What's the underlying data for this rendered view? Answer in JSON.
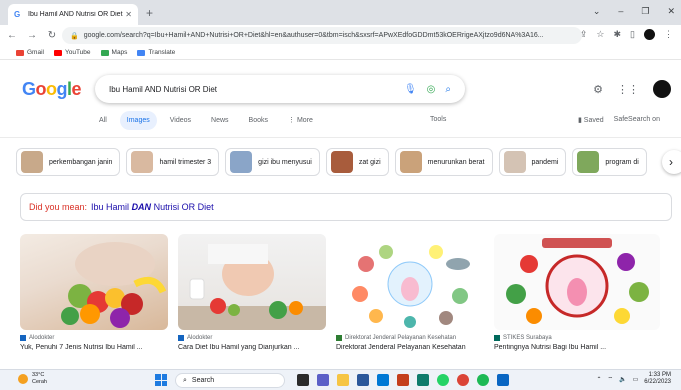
{
  "browser": {
    "tab_title": "Ibu Hamil AND Nutrisi OR Diet",
    "url": "google.com/search?q=Ibu+Hamil+AND+Nutrisi+OR+Diet&hl=en&authuser=0&tbm=isch&sxsrf=APwXEdfoGDDmt53kOERrigeAXjtzo9d6NA%3A16...",
    "bookmarks": [
      "Gmail",
      "YouTube",
      "Maps",
      "Translate"
    ]
  },
  "search": {
    "query": "Ibu Hamil AND Nutrisi OR Diet",
    "tabs": [
      "All",
      "Images",
      "Videos",
      "News",
      "Books",
      "More"
    ],
    "active_tab": "Images",
    "tools_label": "Tools",
    "saved_label": "Saved",
    "safesearch_label": "SafeSearch on"
  },
  "chips": [
    {
      "label": "perkembangan janin",
      "color": "#c8a98a"
    },
    {
      "label": "hamil trimester 3",
      "color": "#d9b9a0"
    },
    {
      "label": "gizi ibu menyusui",
      "color": "#8aa5c8"
    },
    {
      "label": "zat gizi",
      "color": "#a85c3c"
    },
    {
      "label": "menurunkan berat",
      "color": "#caa27a"
    },
    {
      "label": "pandemi",
      "color": "#d4c3b4"
    },
    {
      "label": "program di",
      "color": "#7fa85c"
    }
  ],
  "did_you_mean": {
    "lead": "Did you mean:",
    "pre": "Ibu Hamil",
    "bold": "DAN",
    "post": "Nutrisi OR Diet"
  },
  "results": [
    {
      "source": "Alodokter",
      "caption": "Yuk, Penuhi 7 Jenis Nutrisi Ibu Hamil ..."
    },
    {
      "source": "Alodokter",
      "caption": "Cara Diet Ibu Hamil yang Dianjurkan ..."
    },
    {
      "source": "Direktorat Jenderal Pelayanan Kesehatan",
      "caption": "Direktorat Jenderal Pelayanan Kesehatan"
    },
    {
      "source": "STIKES Surabaya",
      "caption": "Pentingnya Nutrisi Bagi Ibu Hamil ..."
    }
  ],
  "taskbar": {
    "temp": "33°C",
    "weather": "Cerah",
    "search_label": "Search",
    "time": "1:33 PM",
    "date": "6/22/2023"
  }
}
